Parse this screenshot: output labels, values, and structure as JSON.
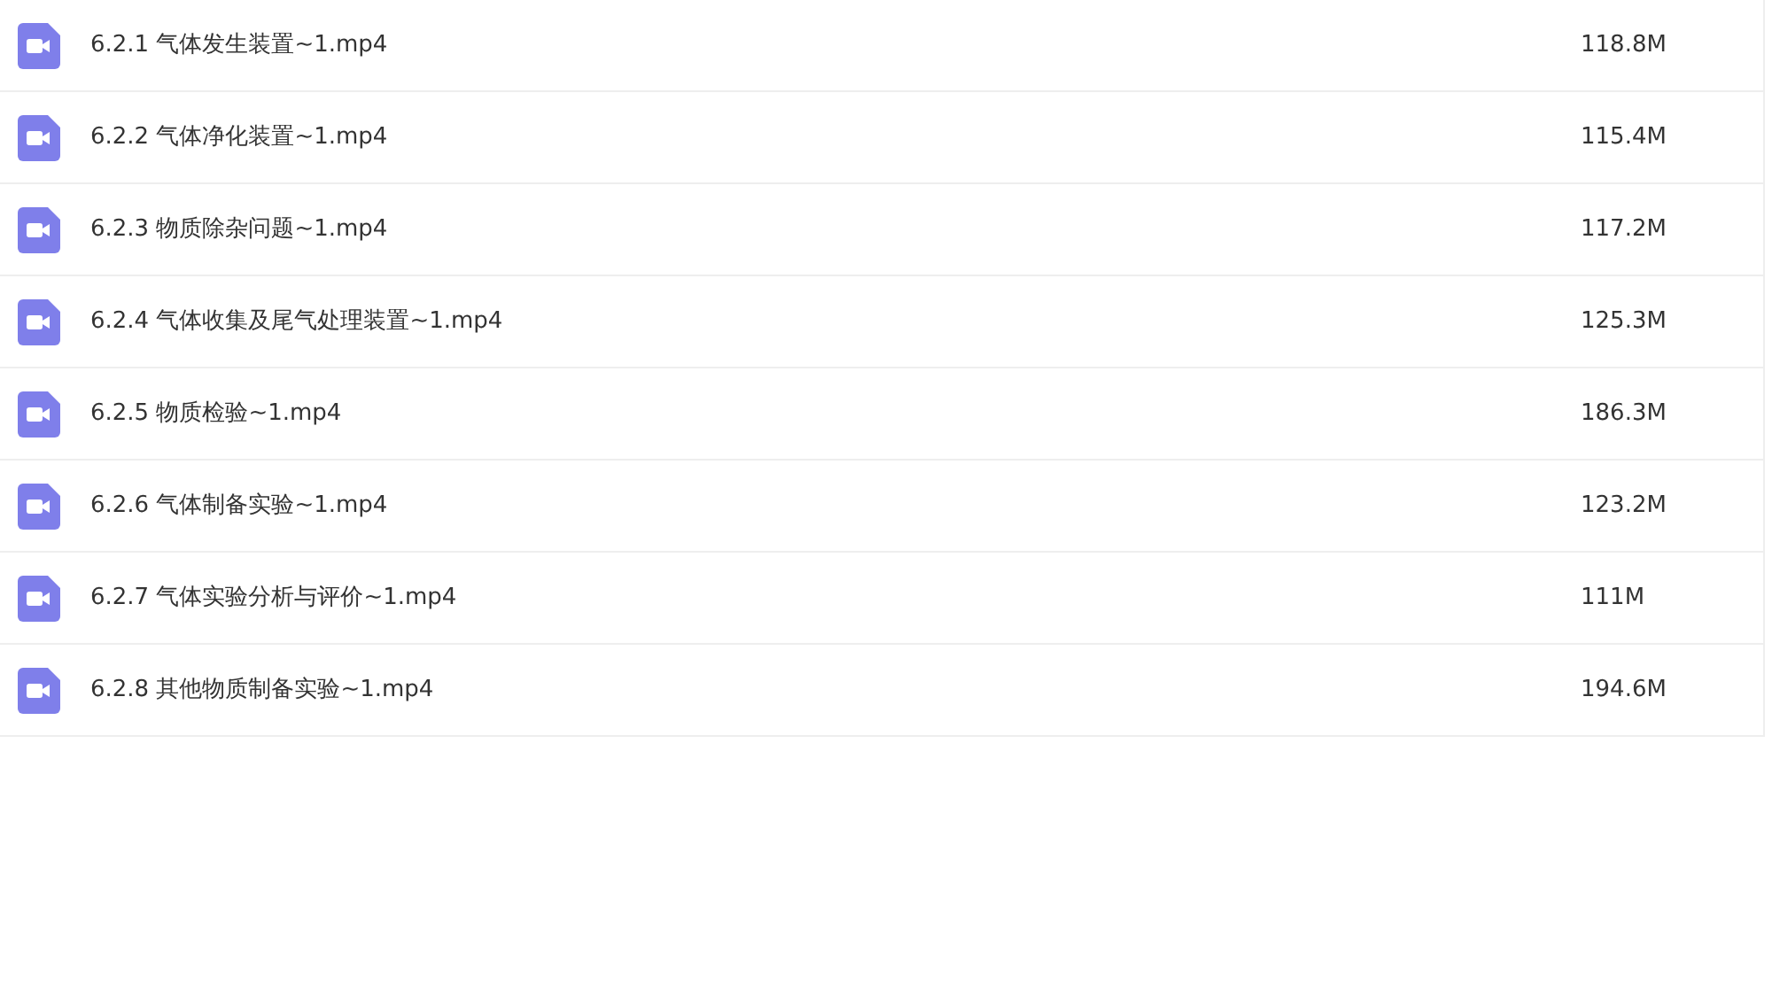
{
  "files": [
    {
      "name": "6.2.1 气体发生装置~1.mp4",
      "size": "118.8M"
    },
    {
      "name": "6.2.2 气体净化装置~1.mp4",
      "size": "115.4M"
    },
    {
      "name": "6.2.3 物质除杂问题~1.mp4",
      "size": "117.2M"
    },
    {
      "name": "6.2.4 气体收集及尾气处理装置~1.mp4",
      "size": "125.3M"
    },
    {
      "name": "6.2.5 物质检验~1.mp4",
      "size": "186.3M"
    },
    {
      "name": "6.2.6 气体制备实验~1.mp4",
      "size": "123.2M"
    },
    {
      "name": "6.2.7 气体实验分析与评价~1.mp4",
      "size": "111M"
    },
    {
      "name": "6.2.8 其他物质制备实验~1.mp4",
      "size": "194.6M"
    }
  ]
}
